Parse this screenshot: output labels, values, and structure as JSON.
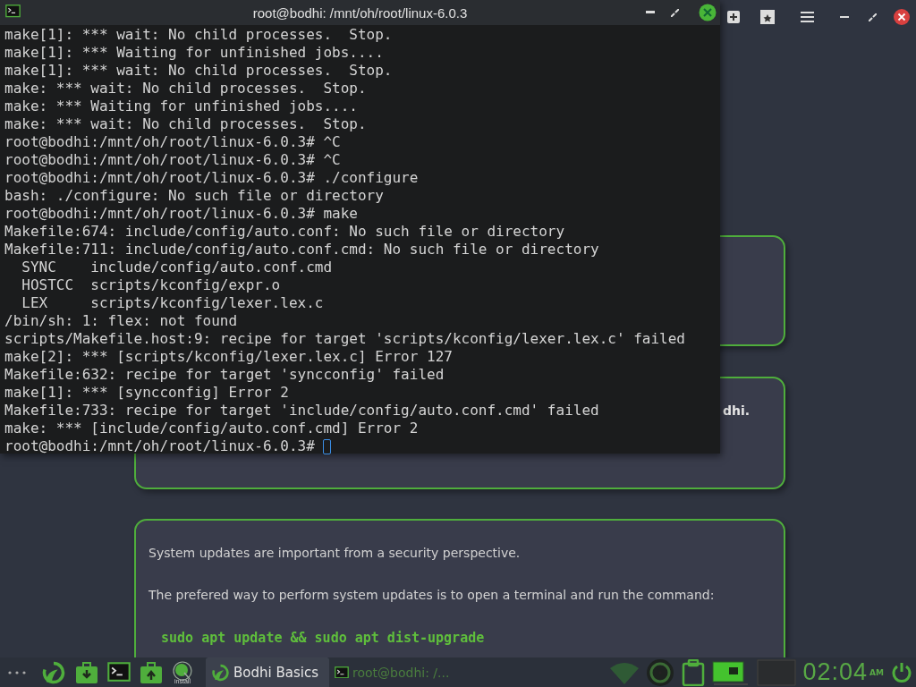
{
  "browser": {
    "cards": [
      {
        "kind": "blank"
      },
      {
        "kind": "fragment",
        "text": "dhi."
      },
      {
        "kind": "content",
        "paragraphs": [
          "System updates are important from a security perspective.",
          "The prefered way to perform system updates is to open a terminal and run the command:"
        ],
        "command": "sudo apt update && sudo apt dist-upgrade"
      }
    ]
  },
  "terminal": {
    "title": "root@bodhi: /mnt/oh/root/linux-6.0.3",
    "lines": [
      "make[1]: *** wait: No child processes.  Stop.",
      "make[1]: *** Waiting for unfinished jobs....",
      "make[1]: *** wait: No child processes.  Stop.",
      "make: *** wait: No child processes.  Stop.",
      "make: *** Waiting for unfinished jobs....",
      "make: *** wait: No child processes.  Stop.",
      "root@bodhi:/mnt/oh/root/linux-6.0.3# ^C",
      "root@bodhi:/mnt/oh/root/linux-6.0.3# ^C",
      "root@bodhi:/mnt/oh/root/linux-6.0.3# ./configure",
      "bash: ./configure: No such file or directory",
      "root@bodhi:/mnt/oh/root/linux-6.0.3# make",
      "Makefile:674: include/config/auto.conf: No such file or directory",
      "Makefile:711: include/config/auto.conf.cmd: No such file or directory",
      "  SYNC    include/config/auto.conf.cmd",
      "  HOSTCC  scripts/kconfig/expr.o",
      "  LEX     scripts/kconfig/lexer.lex.c",
      "/bin/sh: 1: flex: not found",
      "scripts/Makefile.host:9: recipe for target 'scripts/kconfig/lexer.lex.c' failed",
      "make[2]: *** [scripts/kconfig/lexer.lex.c] Error 127",
      "Makefile:632: recipe for target 'syncconfig' failed",
      "make[1]: *** [syncconfig] Error 2",
      "Makefile:733: recipe for target 'include/config/auto.conf.cmd' failed",
      "make: *** [include/config/auto.conf.cmd] Error 2"
    ],
    "prompt": "root@bodhi:/mnt/oh/root/linux-6.0.3# "
  },
  "taskbar": {
    "install_label": "install",
    "tasks": [
      {
        "label": "Bodhi Basics",
        "selected": true
      },
      {
        "label": "root@bodhi: /...",
        "selected": false
      }
    ],
    "clock": "02:04",
    "meridiem": "AM"
  }
}
